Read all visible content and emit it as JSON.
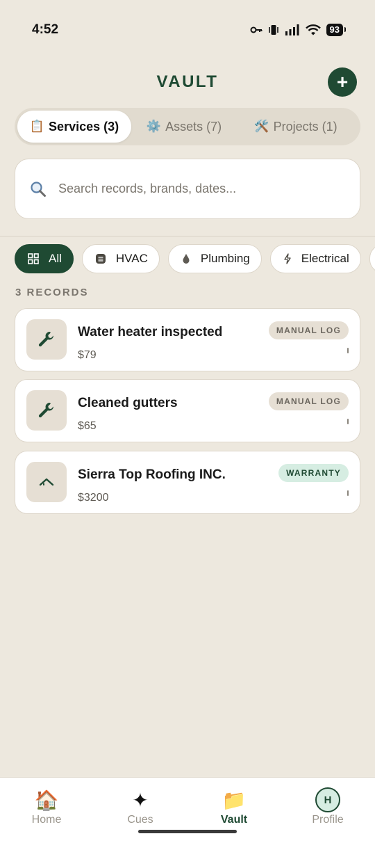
{
  "status_bar": {
    "time": "4:52",
    "battery": "93"
  },
  "header": {
    "title": "VAULT",
    "add_label": "+"
  },
  "segments": [
    {
      "icon": "📋",
      "label": "Services (3)"
    },
    {
      "icon": "⚙️",
      "label": "Assets (7)"
    },
    {
      "icon": "🛠️",
      "label": "Projects (1)"
    }
  ],
  "search": {
    "placeholder": "Search records, brands, dates..."
  },
  "filters": [
    {
      "label": "All",
      "icon": "grid-icon"
    },
    {
      "label": "HVAC",
      "icon": "hvac-icon"
    },
    {
      "label": "Plumbing",
      "icon": "droplet-icon"
    },
    {
      "label": "Electrical",
      "icon": "bolt-icon"
    }
  ],
  "records_label": "3 RECORDS",
  "records": [
    {
      "title": "Water heater inspected",
      "price": "$79",
      "badge": "MANUAL LOG",
      "icon": "wrench-icon"
    },
    {
      "title": "Cleaned gutters",
      "price": "$65",
      "badge": "MANUAL LOG",
      "icon": "wrench-icon"
    },
    {
      "title": "Sierra Top Roofing INC.",
      "price": "$3200",
      "badge": "WARRANTY",
      "icon": "roof-icon"
    }
  ],
  "nav": [
    {
      "label": "Home",
      "icon": "🏠"
    },
    {
      "label": "Cues",
      "icon": "✦"
    },
    {
      "label": "Vault",
      "icon": "📁"
    },
    {
      "label": "Profile",
      "icon": "H"
    }
  ],
  "colors": {
    "accent": "#1f4a33",
    "background": "#ede8de",
    "warranty_bg": "#d6ede2"
  }
}
